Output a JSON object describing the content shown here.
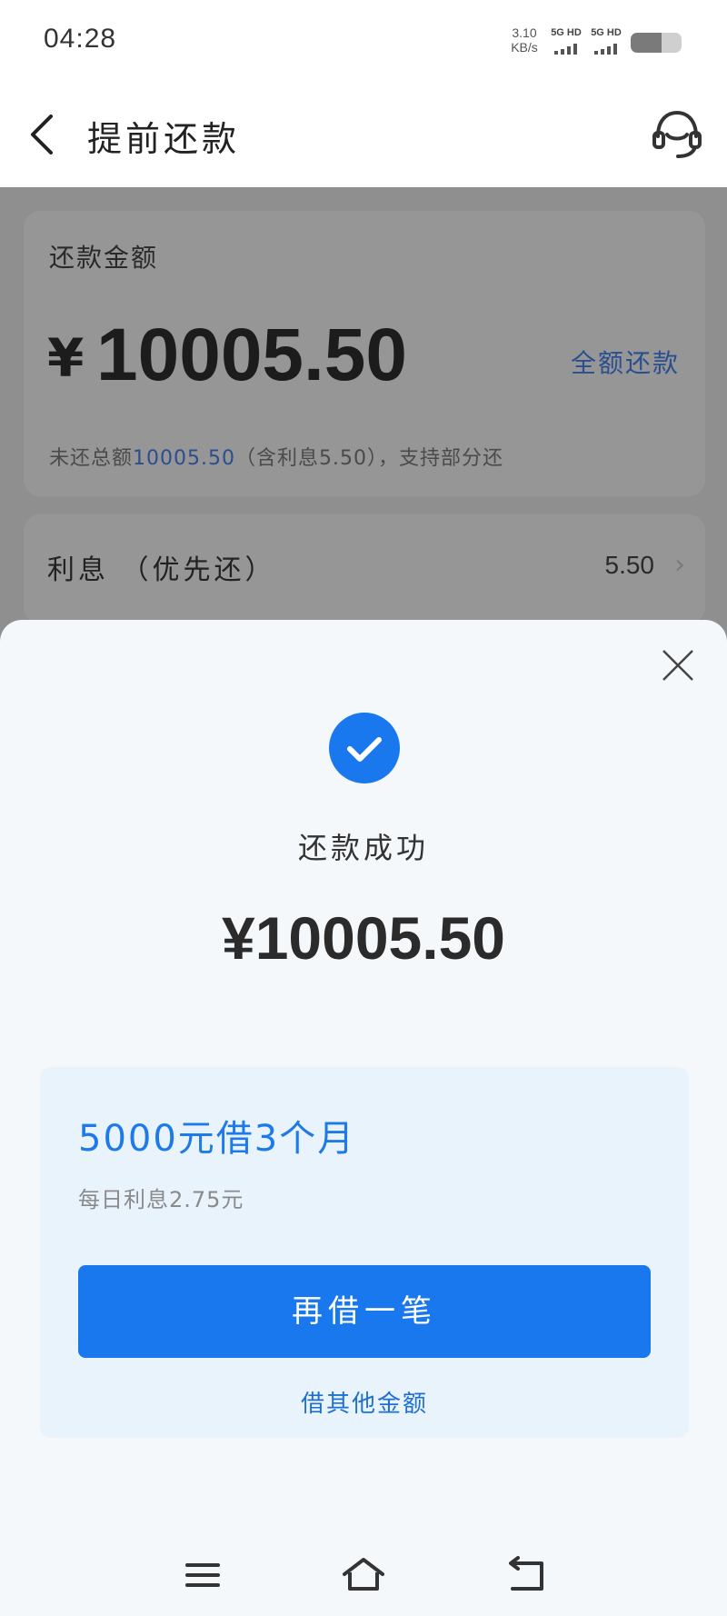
{
  "status_bar": {
    "time": "04:28",
    "net_speed_value": "3.10",
    "net_speed_unit": "KB/s",
    "sim1_label": "5G HD",
    "sim2_label": "5G HD",
    "battery_level": 0.6
  },
  "header": {
    "title": "提前还款",
    "back_icon": "chevron-left-icon",
    "service_icon": "customer-service-headset-icon"
  },
  "repay_card": {
    "label": "还款金额",
    "currency": "¥",
    "amount": "10005.50",
    "full_repay_label": "全额还款",
    "outstanding_prefix": "未还总额",
    "outstanding_amount": "10005.50",
    "outstanding_suffix": "（含利息5.50），支持部分还"
  },
  "interest_row": {
    "label": "利息 （优先还）",
    "value": "5.50"
  },
  "sheet": {
    "close_icon": "close-icon",
    "success_icon": "check-circle-icon",
    "success_text": "还款成功",
    "amount": "¥10005.50",
    "promo": {
      "title": "5000元借3个月",
      "subtitle": "每日利息2.75元",
      "button_label": "再借一笔",
      "link_label": "借其他金额"
    }
  },
  "colors": {
    "accent": "#1a78ee",
    "promo_bg": "#e9f3fc",
    "overlay_bg": "#8f8f8f",
    "sheet_bg": "#f4f8fb"
  },
  "nav_bar": {
    "menu_icon": "menu-icon",
    "home_icon": "home-icon",
    "back_icon": "return-icon"
  }
}
